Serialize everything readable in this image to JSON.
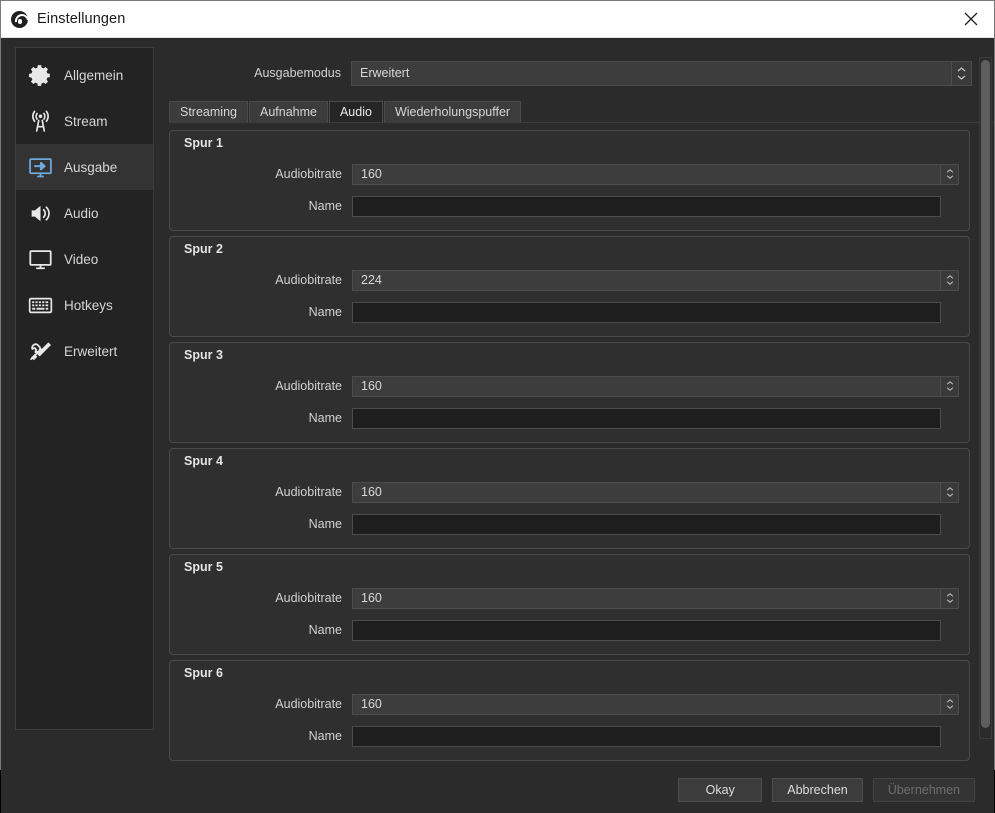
{
  "window": {
    "title": "Einstellungen",
    "app_icon": "obs-logo-icon",
    "close_icon": "close-icon"
  },
  "sidebar": {
    "items": [
      {
        "label": "Allgemein",
        "icon": "gear-icon",
        "selected": false
      },
      {
        "label": "Stream",
        "icon": "broadcast-icon",
        "selected": false
      },
      {
        "label": "Ausgabe",
        "icon": "output-monitor-icon",
        "selected": true
      },
      {
        "label": "Audio",
        "icon": "speaker-icon",
        "selected": false
      },
      {
        "label": "Video",
        "icon": "monitor-icon",
        "selected": false
      },
      {
        "label": "Hotkeys",
        "icon": "keyboard-icon",
        "selected": false
      },
      {
        "label": "Erweitert",
        "icon": "tools-icon",
        "selected": false
      }
    ]
  },
  "output_mode": {
    "label": "Ausgabemodus",
    "value": "Erweitert",
    "spinner_icon": "updown-chevron-icon"
  },
  "tabs": [
    {
      "label": "Streaming",
      "active": false
    },
    {
      "label": "Aufnahme",
      "active": false
    },
    {
      "label": "Audio",
      "active": true
    },
    {
      "label": "Wiederholungspuffer",
      "active": false
    }
  ],
  "labels": {
    "bitrate": "Audiobitrate",
    "name": "Name",
    "name_placeholder": ""
  },
  "tracks": [
    {
      "title": "Spur 1",
      "bitrate": "160",
      "name": ""
    },
    {
      "title": "Spur 2",
      "bitrate": "224",
      "name": ""
    },
    {
      "title": "Spur 3",
      "bitrate": "160",
      "name": ""
    },
    {
      "title": "Spur 4",
      "bitrate": "160",
      "name": ""
    },
    {
      "title": "Spur 5",
      "bitrate": "160",
      "name": ""
    },
    {
      "title": "Spur 6",
      "bitrate": "160",
      "name": ""
    }
  ],
  "footer": {
    "ok": "Okay",
    "cancel": "Abbrechen",
    "apply": "Übernehmen",
    "apply_disabled": true
  },
  "colors": {
    "window_bg": "#2b2b2b",
    "sidebar_bg": "#232323",
    "selected_bg": "#333333",
    "accent_blue": "#6ea8dc",
    "titlebar_bg": "#ffffff",
    "text": "#d6d6d6"
  }
}
